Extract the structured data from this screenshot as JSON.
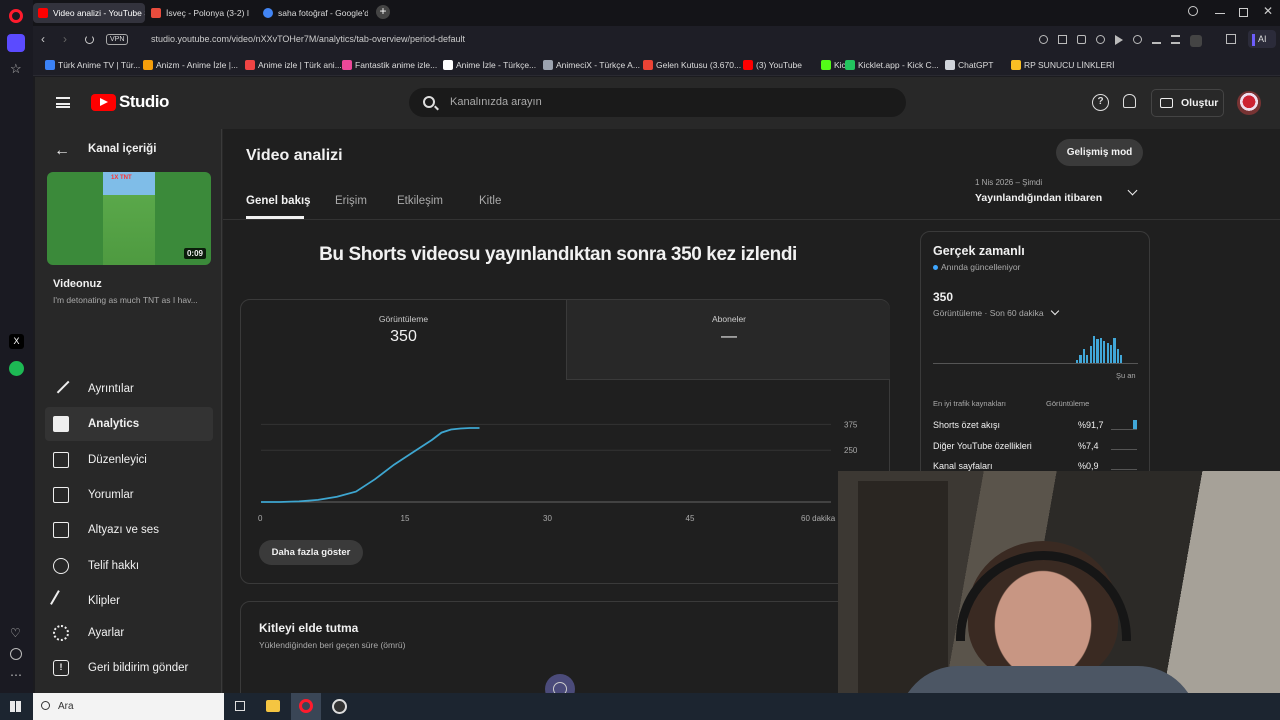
{
  "browser": {
    "tabs": [
      {
        "label": "Video analizi - YouTube S",
        "color": "#ff0000",
        "active": true
      },
      {
        "label": "İsveç - Polonya (3-2) I",
        "color": "#e84c3d",
        "active": false
      },
      {
        "label": "saha fotoğraf - Google'da",
        "color": "#4285f4",
        "active": false
      }
    ],
    "url": "studio.youtube.com/video/nXXvTOHer7M/analytics/tab-overview/period-default",
    "vpn_label": "VPN",
    "ai_label": "AI",
    "bookmarks": [
      {
        "label": "Türk Anime TV | Tür...",
        "color": "#3b82f6"
      },
      {
        "label": "Anizm - Anime İzle |...",
        "color": "#f59e0b"
      },
      {
        "label": "Anime izle | Türk ani...",
        "color": "#ef4444"
      },
      {
        "label": "Fantastik anime izle...",
        "color": "#ec4899"
      },
      {
        "label": "Anime İzle - Türkçe...",
        "color": "#ffffff"
      },
      {
        "label": "AnimeciX - Türkçe A...",
        "color": "#9ca3af"
      },
      {
        "label": "Gelen Kutusu (3.670...",
        "color": "#ea4335"
      },
      {
        "label": "(3) YouTube",
        "color": "#ff0000"
      },
      {
        "label": "Kick",
        "color": "#53fc18"
      },
      {
        "label": "Kicklet.app - Kick C...",
        "color": "#22c55e"
      },
      {
        "label": "ChatGPT",
        "color": "#d1d5db"
      },
      {
        "label": "RP SUNUCU LİNKLERİ",
        "color": "#fbbf24"
      }
    ]
  },
  "studio": {
    "logo_text": "Studio",
    "search_placeholder": "Kanalınızda arayın",
    "create_label": "Oluştur",
    "back_label": "Kanal içeriği",
    "video_duration": "0:09",
    "video_section_title": "Videonuz",
    "video_title": "I'm detonating as much TNT as I hav...",
    "thumbnail_text": "1X TNT",
    "nav": [
      {
        "label": "Ayrıntılar",
        "icon": "pencil-icon",
        "active": false
      },
      {
        "label": "Analytics",
        "icon": "analytics-icon",
        "active": true
      },
      {
        "label": "Düzenleyici",
        "icon": "editor-icon",
        "active": false
      },
      {
        "label": "Yorumlar",
        "icon": "comments-icon",
        "active": false
      },
      {
        "label": "Altyazı ve ses",
        "icon": "subtitles-icon",
        "active": false
      },
      {
        "label": "Telif hakkı",
        "icon": "copyright-icon",
        "active": false
      },
      {
        "label": "Klipler",
        "icon": "scissors-icon",
        "active": false
      }
    ],
    "settings_label": "Ayarlar",
    "feedback_label": "Geri bildirim gönder",
    "page_title": "Video analizi",
    "advanced_mode_label": "Gelişmiş mod",
    "tabs": [
      "Genel bakış",
      "Erişim",
      "Etkileşim",
      "Kitle"
    ],
    "period_top": "1 Nis 2026 – Şimdi",
    "period_label": "Yayınlandığından itibaren",
    "headline": "Bu Shorts videosu yayınlandıktan sonra 350 kez izlendi",
    "metrics": [
      {
        "label": "Görüntüleme",
        "value": "350"
      },
      {
        "label": "Aboneler",
        "value": "—"
      }
    ],
    "show_more_label": "Daha fazla göster",
    "retention_title": "Kitleyi elde tutma",
    "retention_subtitle": "Yüklendiğinden beri geçen süre (ömrü)",
    "realtime": {
      "title": "Gerçek zamanlı",
      "subtitle": "Anında güncelleniyor",
      "value": "350",
      "metric_label": "Görüntüleme · Son 60 dakika",
      "now_label": "Şu an",
      "sources_header": "En iyi trafik kaynakları",
      "sources_col": "Görüntüleme",
      "sources": [
        {
          "name": "Shorts özet akışı",
          "value": "%91,7"
        },
        {
          "name": "Diğer YouTube özellikleri",
          "value": "%7,4"
        },
        {
          "name": "Kanal sayfaları",
          "value": "%0,9"
        }
      ]
    }
  },
  "chart_data": {
    "type": "line",
    "title": "",
    "xlabel": "",
    "ylabel": "",
    "x_ticks": [
      "0",
      "15",
      "30",
      "45",
      "60 dakika"
    ],
    "y_ticks": [
      "375",
      "250"
    ],
    "xlim": [
      0,
      60
    ],
    "ylim": [
      0,
      420
    ],
    "series": [
      {
        "x": [
          0,
          2,
          4,
          6,
          8,
          10,
          12,
          14,
          16,
          18,
          19,
          20,
          21,
          22,
          23
        ],
        "values": [
          0,
          0,
          3,
          10,
          25,
          50,
          110,
          180,
          240,
          300,
          335,
          350,
          355,
          357,
          357
        ]
      }
    ],
    "color": "#3ea6d0",
    "grid": true
  },
  "realtime_bars": [
    0.1,
    0.3,
    0.5,
    0.3,
    0.6,
    0.95,
    0.85,
    0.9,
    0.8,
    0.7,
    0.65,
    0.9,
    0.5,
    0.3
  ],
  "taskbar": {
    "search_placeholder": "Ara"
  },
  "colors": {
    "accent": "#3ea6ff",
    "youtube_red": "#ff0000"
  }
}
